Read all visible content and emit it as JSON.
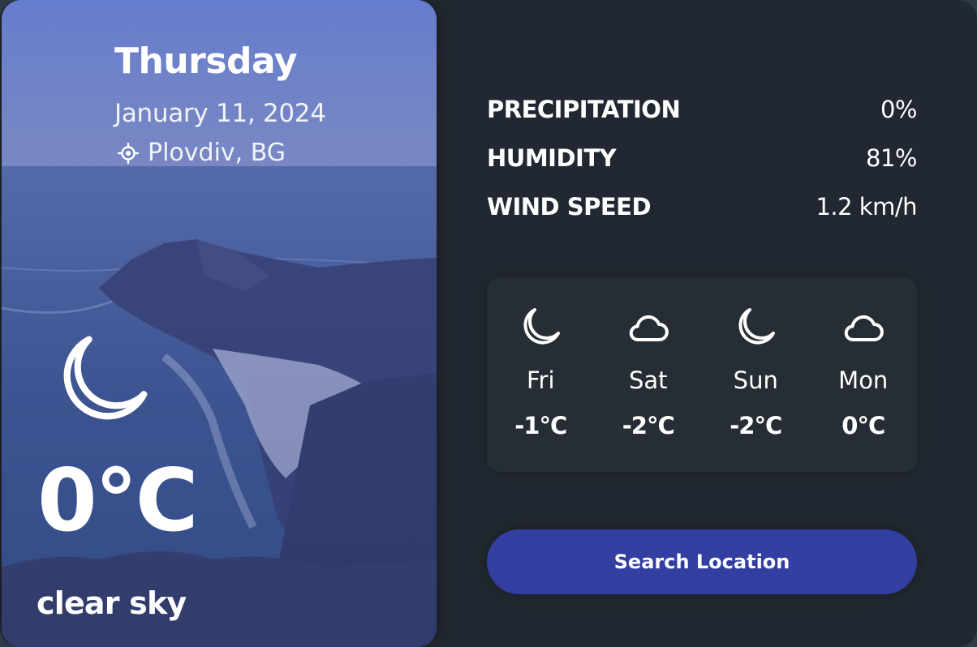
{
  "hero": {
    "day": "Thursday",
    "date": "January 11, 2024",
    "location": "Plovdiv, BG",
    "current_icon": "moon-icon",
    "temperature": "0°C",
    "description": "clear sky"
  },
  "stats": [
    {
      "label": "PRECIPITATION",
      "value": "0%"
    },
    {
      "label": "HUMIDITY",
      "value": "81%"
    },
    {
      "label": "WIND SPEED",
      "value": "1.2 km/h"
    }
  ],
  "forecast": [
    {
      "day": "Fri",
      "temp": "-1°C",
      "icon": "moon-icon"
    },
    {
      "day": "Sat",
      "temp": "-2°C",
      "icon": "cloud-icon"
    },
    {
      "day": "Sun",
      "temp": "-2°C",
      "icon": "moon-icon"
    },
    {
      "day": "Mon",
      "temp": "0°C",
      "icon": "cloud-icon"
    }
  ],
  "search": {
    "label": "Search Location"
  },
  "colors": {
    "card_bg": "#222831",
    "forecast_bg": "#272d35",
    "button_bg": "#323ea0",
    "hero_tint": "#5a6fbf"
  }
}
